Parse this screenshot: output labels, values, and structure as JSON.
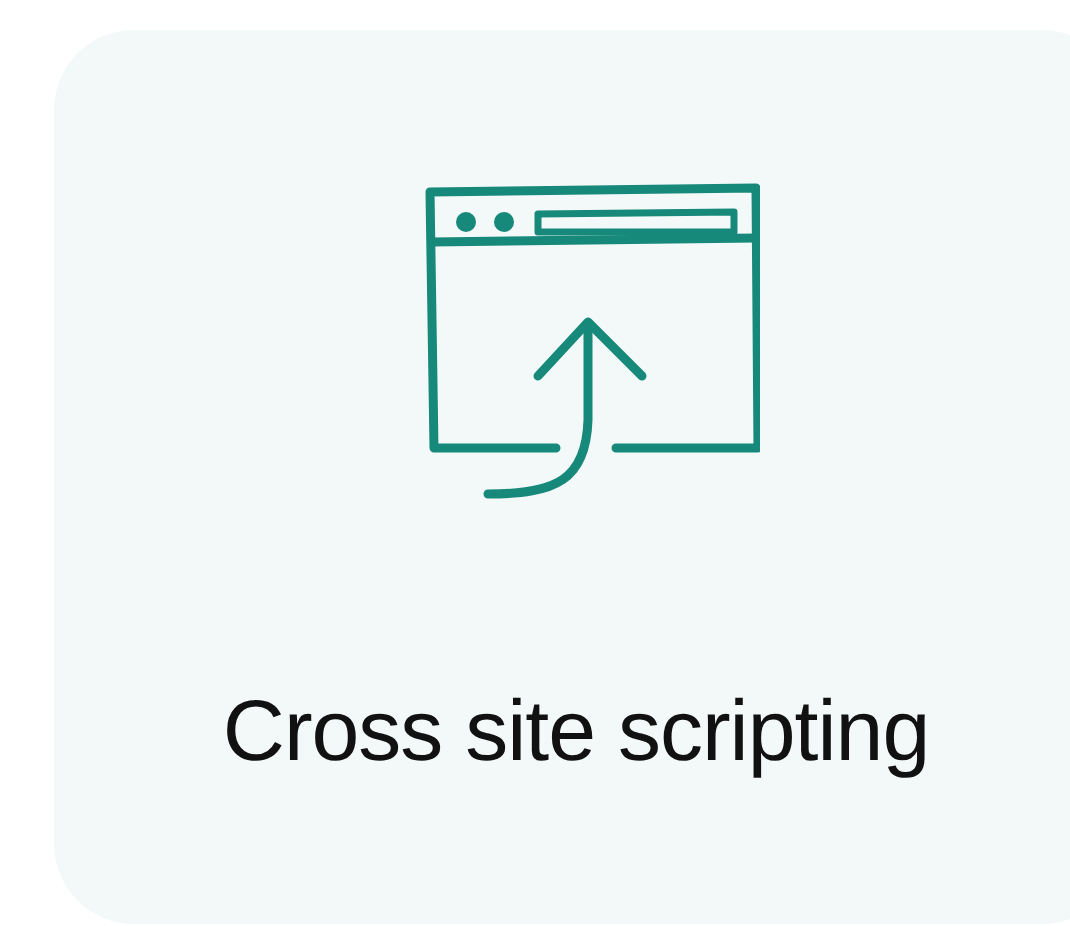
{
  "card": {
    "title": "Cross site scripting"
  }
}
